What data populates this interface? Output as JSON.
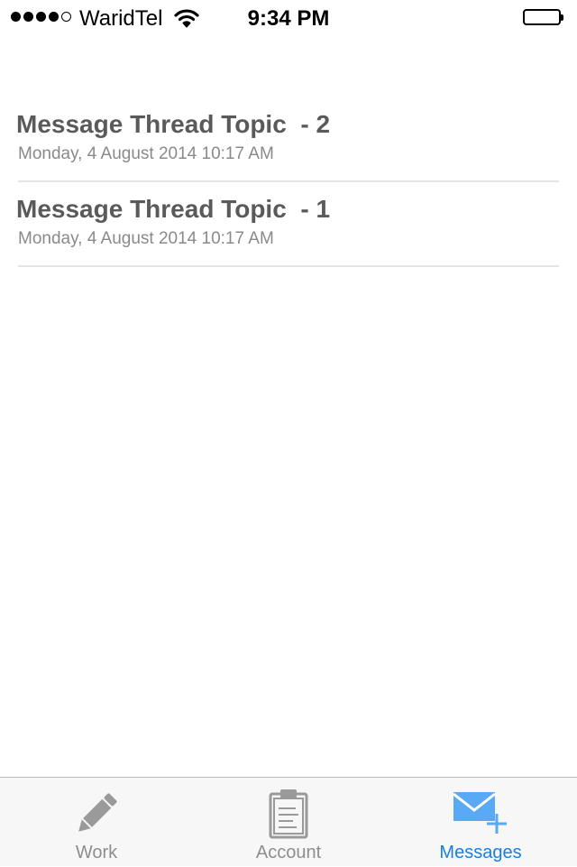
{
  "status_bar": {
    "carrier": "WaridTel",
    "time": "9:34 PM",
    "signal_bars": 4,
    "signal_max": 5,
    "battery_level": 1.0
  },
  "threads": [
    {
      "title": "Message Thread Topic  - 2",
      "date": "Monday, 4 August 2014 10:17 AM"
    },
    {
      "title": "Message Thread Topic  - 1",
      "date": "Monday, 4 August 2014 10:17 AM"
    }
  ],
  "tab_bar": {
    "tabs": [
      {
        "label": "Work",
        "icon": "pencil-icon",
        "active": false
      },
      {
        "label": "Account",
        "icon": "clipboard-icon",
        "active": false
      },
      {
        "label": "Messages",
        "icon": "compose-mail-icon",
        "active": true
      }
    ],
    "active_color": "#1a7fe0",
    "inactive_color": "#8e8e8e"
  }
}
